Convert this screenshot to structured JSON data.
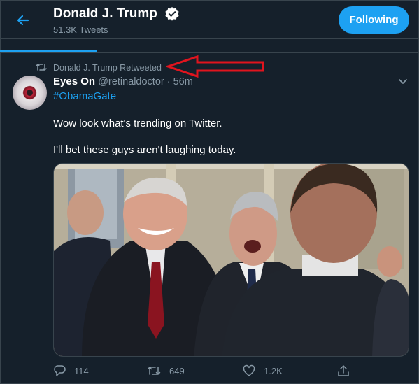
{
  "header": {
    "name": "Donald J. Trump",
    "tweet_count": "51.3K Tweets",
    "follow_label": "Following"
  },
  "retweet": {
    "text": "Donald J. Trump Retweeted"
  },
  "tweet": {
    "author_name": "Eyes On",
    "author_handle_time": "@retinaldoctor · 56m",
    "hashtag": "#ObamaGate",
    "line1": "Wow look what's trending on Twitter.",
    "line2": "I'll bet these guys aren't laughing today."
  },
  "actions": {
    "replies": "114",
    "retweets": "649",
    "likes": "1.2K"
  },
  "colors": {
    "background": "#15202b",
    "accent": "#1da1f2",
    "secondary_text": "#8899a6",
    "annotation_arrow": "#e0141e"
  },
  "icons": [
    "back-arrow-icon",
    "verified-badge-icon",
    "retweet-icon",
    "chevron-down-icon",
    "reply-icon",
    "like-icon",
    "share-icon"
  ]
}
